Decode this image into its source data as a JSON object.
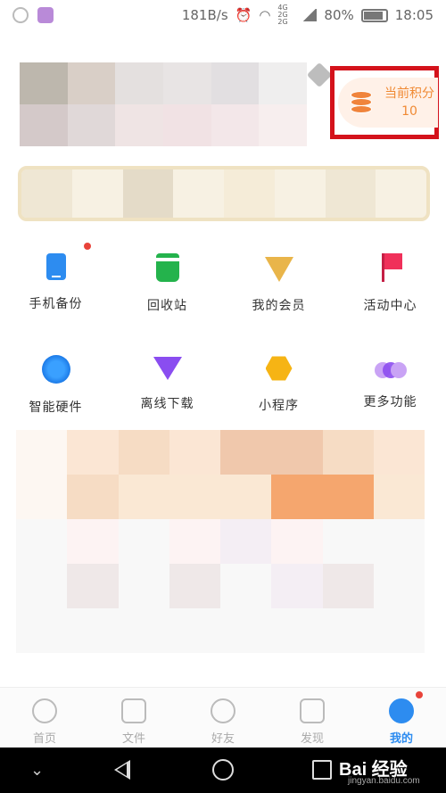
{
  "status_bar": {
    "speed": "181B/s",
    "network": "4G 2G 2G",
    "battery": "80%",
    "time": "18:05"
  },
  "points": {
    "label": "当前积分",
    "value": "10"
  },
  "menu": {
    "row1": [
      {
        "label": "手机备份",
        "icon": "phone-icon"
      },
      {
        "label": "回收站",
        "icon": "trash-icon"
      },
      {
        "label": "我的会员",
        "icon": "diamond-icon"
      },
      {
        "label": "活动中心",
        "icon": "flag-icon"
      }
    ],
    "row2": [
      {
        "label": "智能硬件",
        "icon": "wifi-hardware-icon"
      },
      {
        "label": "离线下载",
        "icon": "download-icon"
      },
      {
        "label": "小程序",
        "icon": "mini-program-icon"
      },
      {
        "label": "更多功能",
        "icon": "more-icon"
      }
    ]
  },
  "tabs": [
    {
      "label": "首页",
      "icon": "cloud-icon"
    },
    {
      "label": "文件",
      "icon": "folder-icon"
    },
    {
      "label": "好友",
      "icon": "friends-icon"
    },
    {
      "label": "发现",
      "icon": "discover-icon"
    },
    {
      "label": "我的",
      "icon": "me-icon",
      "active": true
    }
  ],
  "watermark": {
    "brand": "Bai 经验",
    "url": "jingyan.baidu.com"
  },
  "colors": {
    "accent": "#2d8cf0",
    "highlight": "#d4121b",
    "points_text": "#f08a34",
    "badge": "#e8433a"
  }
}
